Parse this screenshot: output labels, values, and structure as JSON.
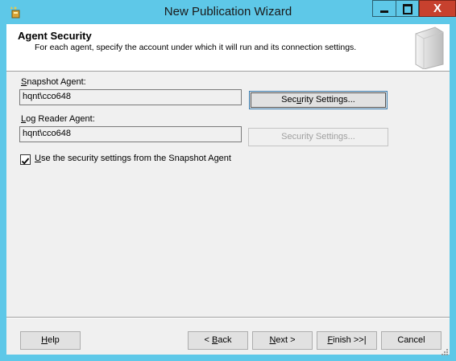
{
  "window": {
    "title": "New Publication Wizard",
    "controls": {
      "minimize": "minimize",
      "maximize": "maximize",
      "close": "X"
    }
  },
  "header": {
    "title": "Agent Security",
    "subtitle": "For each agent, specify the account under which it will run and its connection settings."
  },
  "snapshot": {
    "label_mnemonic": "S",
    "label_rest": "napshot Agent:",
    "account": "hqnt\\cco648",
    "button_pre": "Sec",
    "button_mnemonic": "u",
    "button_post": "rity Settings..."
  },
  "logreader": {
    "label_mnemonic": "L",
    "label_rest": "og Reader Agent:",
    "account": "hqnt\\cco648",
    "button_label": "Security Settings..."
  },
  "checkbox": {
    "checked": true,
    "label_mnemonic": "U",
    "label_rest": "se the security settings from the Snapshot Agent"
  },
  "footer": {
    "help_mnemonic": "H",
    "help_rest": "elp",
    "back_pre": "< ",
    "back_mnemonic": "B",
    "back_rest": "ack",
    "next_mnemonic": "N",
    "next_rest": "ext >",
    "finish_mnemonic": "F",
    "finish_rest": "inish >>|",
    "cancel": "Cancel"
  },
  "colors": {
    "titlebar": "#5ec8e8",
    "close": "#c7412e",
    "dialog_bg": "#f0f0f0",
    "focus_border": "#3c7fb1"
  }
}
